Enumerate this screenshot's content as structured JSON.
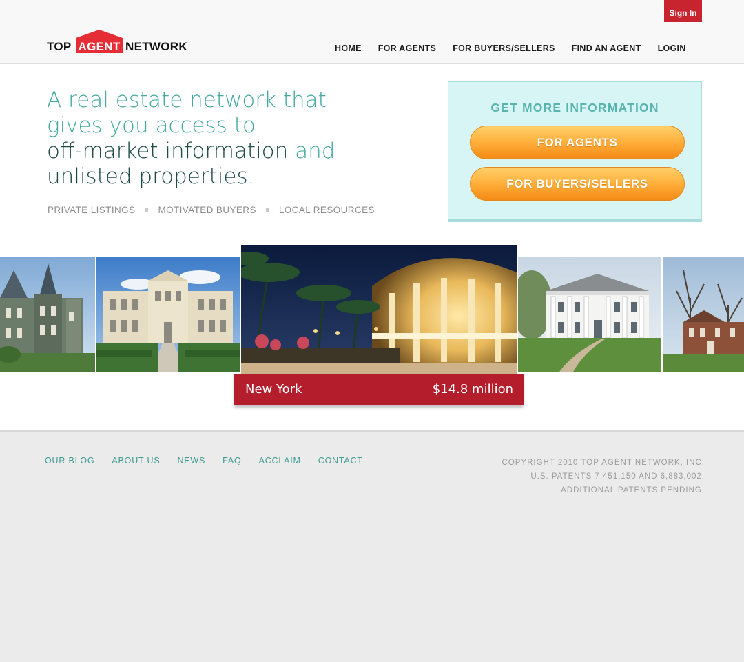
{
  "header": {
    "sign_in": "Sign In",
    "logo": {
      "part1": "TOP",
      "part2": "AGENT",
      "part3": "NETWORK"
    },
    "nav": [
      "HOME",
      "FOR AGENTS",
      "FOR BUYERS/SELLERS",
      "FIND AN AGENT",
      "LOGIN"
    ]
  },
  "hero": {
    "headline_line1": "A real estate network that",
    "headline_line2": "gives you access to",
    "headline_dark1": "off-market information",
    "headline_and": " and",
    "headline_dark2": "unlisted properties",
    "headline_period": ".",
    "tags": [
      "PRIVATE LISTINGS",
      "MOTIVATED BUYERS",
      "LOCAL RESOURCES"
    ]
  },
  "info_box": {
    "title": "GET MORE INFORMATION",
    "button_agents": "FOR AGENTS",
    "button_buyers": "FOR BUYERS/SELLERS"
  },
  "carousel": {
    "featured_city": "New York",
    "featured_price": "$14.8 million"
  },
  "footer": {
    "links": [
      "OUR BLOG",
      "ABOUT US",
      "NEWS",
      "FAQ",
      "ACCLAIM",
      "CONTACT"
    ],
    "copyright": [
      "COPYRIGHT 2010 TOP AGENT NETWORK, INC.",
      "U.S. PATENTS 7,451,150 AND 6,883,002.",
      "ADDITIONAL PATENTS PENDING."
    ]
  },
  "colors": {
    "brand_red": "#c8242f",
    "teal": "#44aaa0",
    "orange": "#ffaf3a"
  }
}
